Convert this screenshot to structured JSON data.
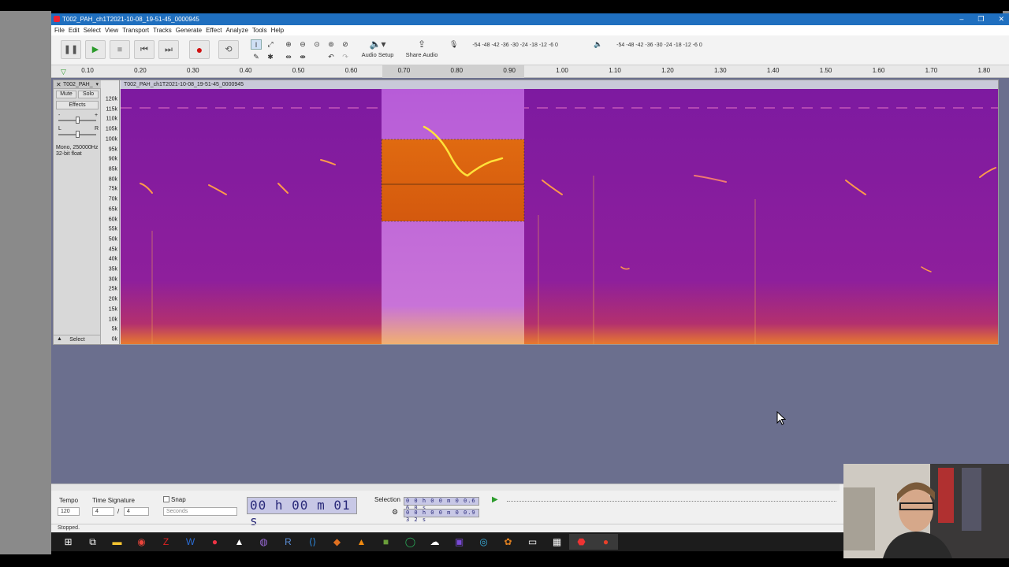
{
  "window": {
    "title": "T002_PAH_ch1T2021-10-08_19-51-45_0000945",
    "controls": [
      "–",
      "❐",
      "✕"
    ]
  },
  "menu": [
    "File",
    "Edit",
    "Select",
    "View",
    "Transport",
    "Tracks",
    "Generate",
    "Effect",
    "Analyze",
    "Tools",
    "Help"
  ],
  "toolbar": {
    "pause": "❚❚",
    "play": "▶",
    "stop": "■",
    "skip_start": "⏮",
    "skip_end": "⏭",
    "record": "●",
    "loop": "⟲",
    "audio_setup_label": "Audio Setup",
    "share_audio_label": "Share Audio",
    "record_meter_scale": "-54 -48 -42 -36 -30 -24 -18 -12 -6 0",
    "play_meter_scale": "-54 -48 -42 -36 -30 -24 -18 -12 -6 0"
  },
  "ruler": {
    "ticks": [
      "0.10",
      "0.20",
      "0.30",
      "0.40",
      "0.50",
      "0.60",
      "0.70",
      "0.80",
      "0.90",
      "1.00",
      "1.10",
      "1.20",
      "1.30",
      "1.40",
      "1.50",
      "1.60",
      "1.70",
      "1.80"
    ]
  },
  "track": {
    "name": "T002_PAH_",
    "clip_name": "T002_PAH_ch1T2021-10-08_19-51-45_0000945",
    "mute_label": "Mute",
    "solo_label": "Solo",
    "effects_label": "Effects",
    "pan_left": "L",
    "pan_right": "R",
    "gain_minus": "-",
    "gain_plus": "+",
    "format_line1": "Mono, 250000Hz",
    "format_line2": "32-bit float",
    "select_label": "Select",
    "freq_labels": [
      "120k",
      "115k",
      "110k",
      "105k",
      "100k",
      "95k",
      "90k",
      "85k",
      "80k",
      "75k",
      "70k",
      "65k",
      "60k",
      "55k",
      "50k",
      "45k",
      "40k",
      "35k",
      "30k",
      "25k",
      "20k",
      "15k",
      "10k",
      "5k",
      "0k"
    ]
  },
  "bottom": {
    "tempo_label": "Tempo",
    "tempo_value": "120",
    "time_signature_label": "Time Signature",
    "ts_numerator": "4",
    "ts_slash": "/",
    "ts_denominator": "4",
    "snap_label": "Snap",
    "snap_unit": "Seconds",
    "time_display": "00 h 00 m 01 s",
    "selection_label": "Selection",
    "selection_start": "0 0 h 0 0 m 0 0.6 6 0 s",
    "selection_end": "0 0 h 0 0 m 0 0.9 3 2 s",
    "status": "Stopped."
  },
  "colors": {
    "titlebar": "#1f6fbf",
    "spectrogram_bg": "#8a1ca0",
    "selection_highlight": "#c877e0",
    "time_display_bg": "#c8c8e6",
    "track_area_bg": "#6b6f8e"
  }
}
